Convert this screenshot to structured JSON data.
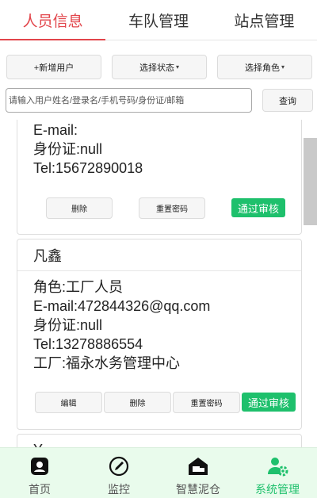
{
  "tabs": [
    {
      "label": "人员信息",
      "active": true
    },
    {
      "label": "车队管理",
      "active": false
    },
    {
      "label": "站点管理",
      "active": false
    }
  ],
  "filters": {
    "add_user": "+新增用户",
    "select_status": "选择状态",
    "select_role": "选择角色"
  },
  "search": {
    "placeholder": "请输入用户姓名/登录名/手机号码/身份证/邮箱",
    "query_label": "查询"
  },
  "cards": [
    {
      "lines": [
        "E-mail:",
        "身份证:null",
        "Tel:15672890018"
      ],
      "buttons": {
        "delete": "删除",
        "reset": "重置密码",
        "approve": "通过审核"
      }
    },
    {
      "name": "凡鑫",
      "lines": [
        "角色:工厂人员",
        "E-mail:472844326@qq.com",
        "身份证:null",
        "Tel:13278886554",
        "工厂:福永水务管理中心"
      ],
      "buttons": {
        "edit": "编辑",
        "delete": "删除",
        "reset": "重置密码",
        "approve": "通过审核"
      }
    },
    {
      "name": "Y"
    }
  ],
  "bottom_nav": [
    {
      "label": "首页",
      "icon": "home-icon",
      "active": false
    },
    {
      "label": "监控",
      "icon": "monitor-icon",
      "active": false
    },
    {
      "label": "智慧泥仓",
      "icon": "warehouse-truck-icon",
      "active": false
    },
    {
      "label": "系统管理",
      "icon": "user-settings-icon",
      "active": true
    }
  ],
  "colors": {
    "accent_red": "#e2454b",
    "approve_green": "#1ec06c",
    "nav_bg": "#e9fbec"
  }
}
